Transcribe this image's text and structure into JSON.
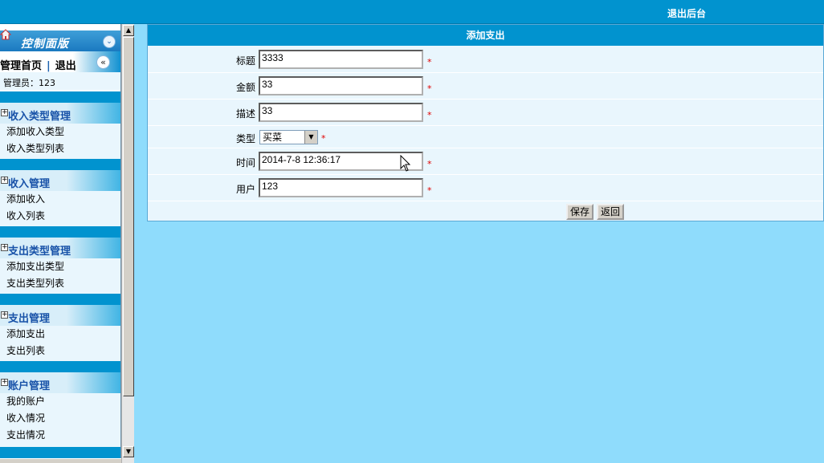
{
  "header": {
    "logout_label": "退出后台"
  },
  "sidebar": {
    "panel_title": "控制面版",
    "collapse_icon": "«",
    "home_link": "管理首页",
    "separator": "|",
    "logout_link": "退出",
    "expand_icon": "«",
    "admin_text": "管理员：123",
    "groups": [
      {
        "title": "收入类型管理",
        "items": [
          "添加收入类型",
          "收入类型列表"
        ]
      },
      {
        "title": "收入管理",
        "items": [
          "添加收入",
          "收入列表"
        ]
      },
      {
        "title": "支出类型管理",
        "items": [
          "添加支出类型",
          "支出类型列表"
        ]
      },
      {
        "title": "支出管理",
        "items": [
          "添加支出",
          "支出列表"
        ]
      },
      {
        "title": "账户管理",
        "items": [
          "我的账户",
          "收入情况",
          "支出情况"
        ]
      }
    ]
  },
  "form": {
    "title": "添加支出",
    "required_mark": "*",
    "fields": [
      {
        "label": "标题",
        "value": "3333"
      },
      {
        "label": "金额",
        "value": "33"
      },
      {
        "label": "描述",
        "value": "33"
      },
      {
        "label": "类型",
        "value": "买菜"
      },
      {
        "label": "时间",
        "value": "2014-7-8 12:36:17"
      },
      {
        "label": "用户",
        "value": "123"
      }
    ],
    "save_label": "保存",
    "back_label": "返回"
  },
  "colors": {
    "topbar": "#0193cf",
    "background": "#8fdcfc",
    "required": "#e00000"
  }
}
